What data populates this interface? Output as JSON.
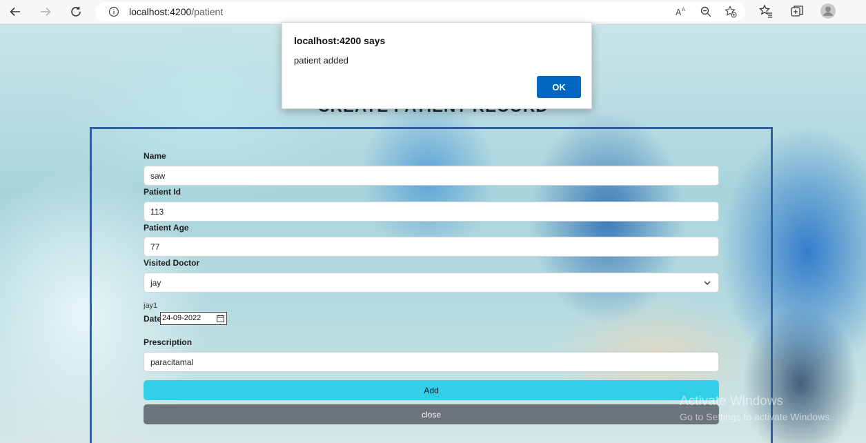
{
  "browser": {
    "url_host": "localhost:4200",
    "url_path": "/patient",
    "icons": [
      "back-icon",
      "forward-icon",
      "refresh-icon",
      "info-icon",
      "read-aloud-icon",
      "zoom-out-icon",
      "add-favorite-icon",
      "favorites-icon",
      "collections-icon",
      "profile-icon"
    ]
  },
  "dialog": {
    "title": "localhost:4200 says",
    "message": "patient added",
    "ok_label": "OK"
  },
  "page": {
    "title": "CREATE PATIENT RECORD",
    "fields": {
      "name_label": "Name",
      "name_value": "saw",
      "patient_id_label": "Patient Id",
      "patient_id_value": "113",
      "patient_age_label": "Patient Age",
      "patient_age_value": "77",
      "visited_doctor_label": "Visited Doctor",
      "visited_doctor_value": "jay",
      "doctor_note": "jay1",
      "date_label": "Date",
      "date_value": "24-09-2022",
      "prescription_label": "Prescription",
      "prescription_value": "paracitamal"
    },
    "buttons": {
      "add_label": "Add",
      "close_label": "close"
    }
  },
  "watermark": {
    "line1": "Activate Windows",
    "line2": "Go to Settings to activate Windows."
  },
  "colors": {
    "add_button": "#32cfe9",
    "close_button": "#6c737b",
    "panel_border": "#2f5fa0",
    "dialog_ok": "#0067c0"
  }
}
